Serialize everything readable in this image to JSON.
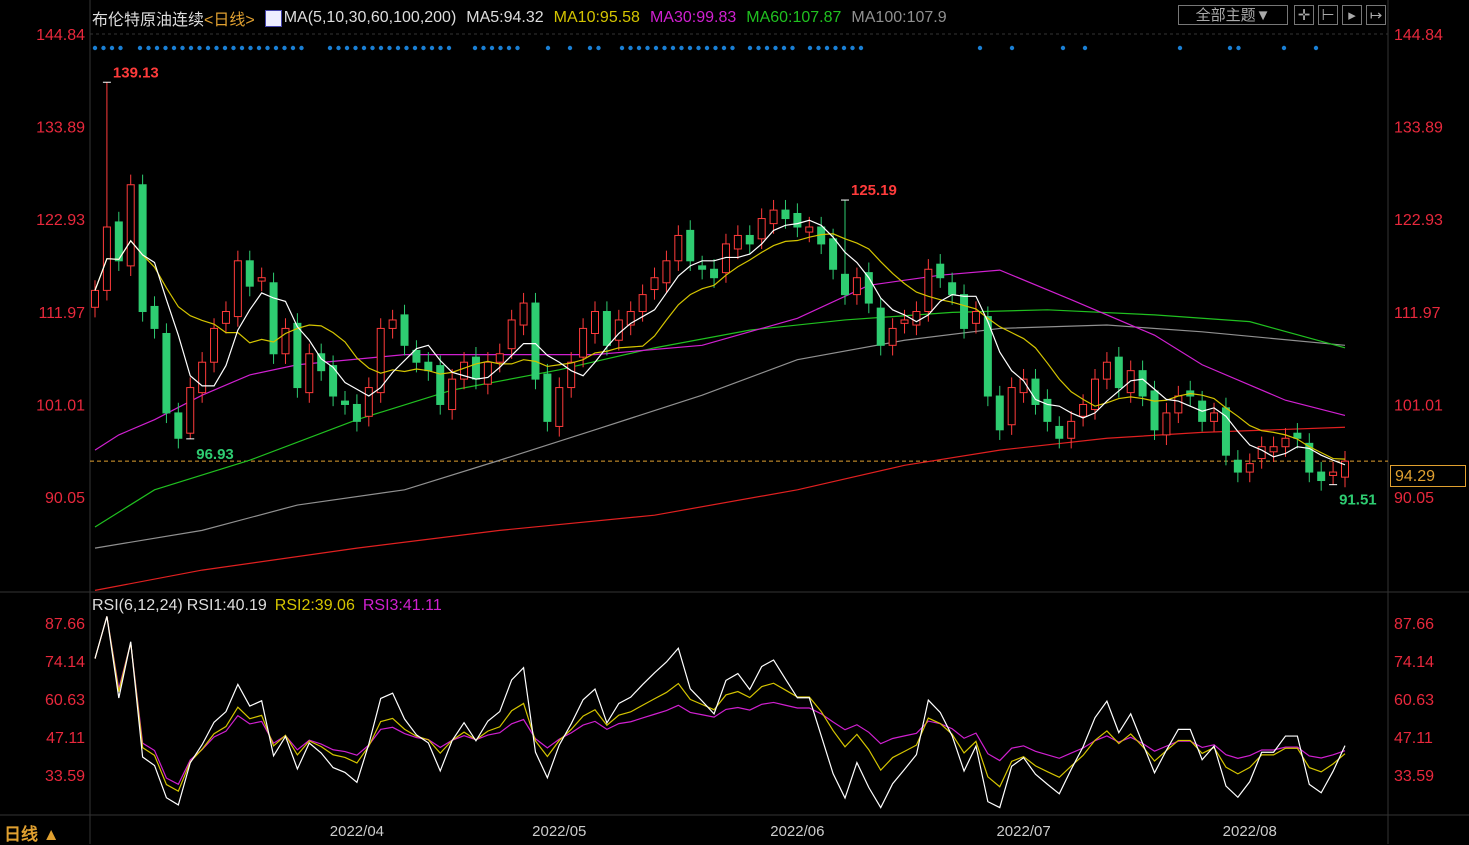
{
  "header": {
    "title": "布伦特原油连续",
    "period": "<日线>",
    "ma_params": "MA(5,10,30,60,100,200)",
    "ma5": "MA5:94.32",
    "ma10": "MA10:95.58",
    "ma30": "MA30:99.83",
    "ma60": "MA60:107.87",
    "ma100": "MA100:107.9"
  },
  "toolbar": {
    "theme_label": "全部主题▼"
  },
  "rsi_header": {
    "params": "RSI(6,12,24)",
    "rsi1": "RSI1:40.19",
    "rsi2": "RSI2:39.06",
    "rsi3": "RSI3:41.11"
  },
  "footer": {
    "period_selector": "日线 ▲"
  },
  "current_price": "94.29",
  "colors": {
    "up": "#ff3b3b",
    "down": "#2ecc71",
    "ma5": "#ffffff",
    "ma10": "#d4c400",
    "ma30": "#d020d0",
    "ma60": "#20c020",
    "ma100": "#909090",
    "ma200": "#e02020",
    "axis": "#e8283c",
    "current": "#e0a030"
  },
  "chart_data": {
    "type": "candlestick",
    "title": "布伦特原油连续 日线",
    "price_axis": {
      "ticks": [
        "144.84",
        "133.89",
        "122.93",
        "111.97",
        "101.01",
        "90.05"
      ],
      "range": [
        75.0,
        144.84
      ]
    },
    "rsi_axis": {
      "ticks": [
        "87.66",
        "74.14",
        "60.63",
        "47.11",
        "33.59"
      ],
      "range": [
        20,
        92
      ]
    },
    "x_ticks": [
      {
        "label": "2022/04",
        "index": 22
      },
      {
        "label": "2022/05",
        "index": 39
      },
      {
        "label": "2022/06",
        "index": 59
      },
      {
        "label": "2022/07",
        "index": 78
      },
      {
        "label": "2022/08",
        "index": 97
      }
    ],
    "close": [
      114.5,
      122,
      118,
      127,
      112,
      110,
      100,
      97,
      103,
      106,
      110,
      112,
      118,
      115,
      116,
      107,
      110,
      103,
      107,
      105,
      102,
      101,
      99,
      103,
      110,
      111,
      108,
      106,
      105,
      101,
      104,
      106,
      104,
      106,
      107,
      111,
      113,
      104,
      99,
      103,
      106,
      110,
      112,
      108,
      111,
      112,
      114,
      116,
      118,
      121,
      118,
      117,
      116,
      120,
      121,
      120,
      123,
      124,
      123,
      122,
      122,
      120,
      117,
      114,
      116,
      113,
      108,
      110,
      111,
      112,
      117,
      116,
      114,
      110,
      112,
      102,
      98,
      103,
      104,
      101,
      99,
      97,
      99,
      101,
      104,
      106,
      103,
      105,
      102,
      98,
      100,
      102,
      102,
      99,
      100,
      95,
      93,
      94,
      96,
      96,
      97,
      97,
      93,
      92,
      93,
      94.29
    ],
    "extremes": [
      {
        "label": "139.13",
        "value": 139.13,
        "index": 1,
        "type": "high"
      },
      {
        "label": "96.93",
        "value": 96.93,
        "index": 8,
        "type": "low"
      },
      {
        "label": "125.19",
        "value": 125.19,
        "index": 63,
        "type": "high"
      },
      {
        "label": "91.51",
        "value": 91.51,
        "index": 104,
        "type": "low"
      }
    ],
    "ma_long": {
      "ma30": [
        [
          0,
          95.6
        ],
        [
          2,
          97.4
        ],
        [
          5,
          99.2
        ],
        [
          9,
          102.1
        ],
        [
          13,
          104.5
        ],
        [
          17,
          105.7
        ],
        [
          26,
          106.9
        ],
        [
          34,
          106.9
        ],
        [
          42,
          106.9
        ],
        [
          51,
          108
        ],
        [
          59,
          111.2
        ],
        [
          65,
          115.1
        ],
        [
          71,
          116.3
        ],
        [
          76,
          116.9
        ],
        [
          82,
          113.4
        ],
        [
          89,
          109.2
        ],
        [
          93,
          105.7
        ],
        [
          100,
          101.5
        ],
        [
          105,
          99.7
        ]
      ],
      "ma60": [
        [
          0,
          86.5
        ],
        [
          5,
          90.9
        ],
        [
          13,
          94.4
        ],
        [
          22,
          99.2
        ],
        [
          30,
          102.7
        ],
        [
          39,
          105.1
        ],
        [
          47,
          107.7
        ],
        [
          55,
          109.8
        ],
        [
          63,
          111
        ],
        [
          72,
          111.9
        ],
        [
          80,
          112.2
        ],
        [
          89,
          111.6
        ],
        [
          97,
          110.8
        ],
        [
          105,
          107.7
        ]
      ],
      "ma100": [
        [
          0,
          84
        ],
        [
          9,
          86.1
        ],
        [
          17,
          89.1
        ],
        [
          26,
          90.9
        ],
        [
          34,
          94.4
        ],
        [
          42,
          98
        ],
        [
          51,
          102.1
        ],
        [
          59,
          106.3
        ],
        [
          68,
          108.6
        ],
        [
          76,
          110
        ],
        [
          85,
          110.4
        ],
        [
          93,
          109.6
        ],
        [
          105,
          108
        ]
      ],
      "ma200": [
        [
          0,
          79
        ],
        [
          9,
          81.4
        ],
        [
          22,
          84
        ],
        [
          34,
          86.1
        ],
        [
          47,
          87.9
        ],
        [
          59,
          90.9
        ],
        [
          68,
          93.8
        ],
        [
          76,
          95.6
        ],
        [
          85,
          97
        ],
        [
          93,
          97.7
        ],
        [
          105,
          98.3
        ]
      ]
    }
  }
}
